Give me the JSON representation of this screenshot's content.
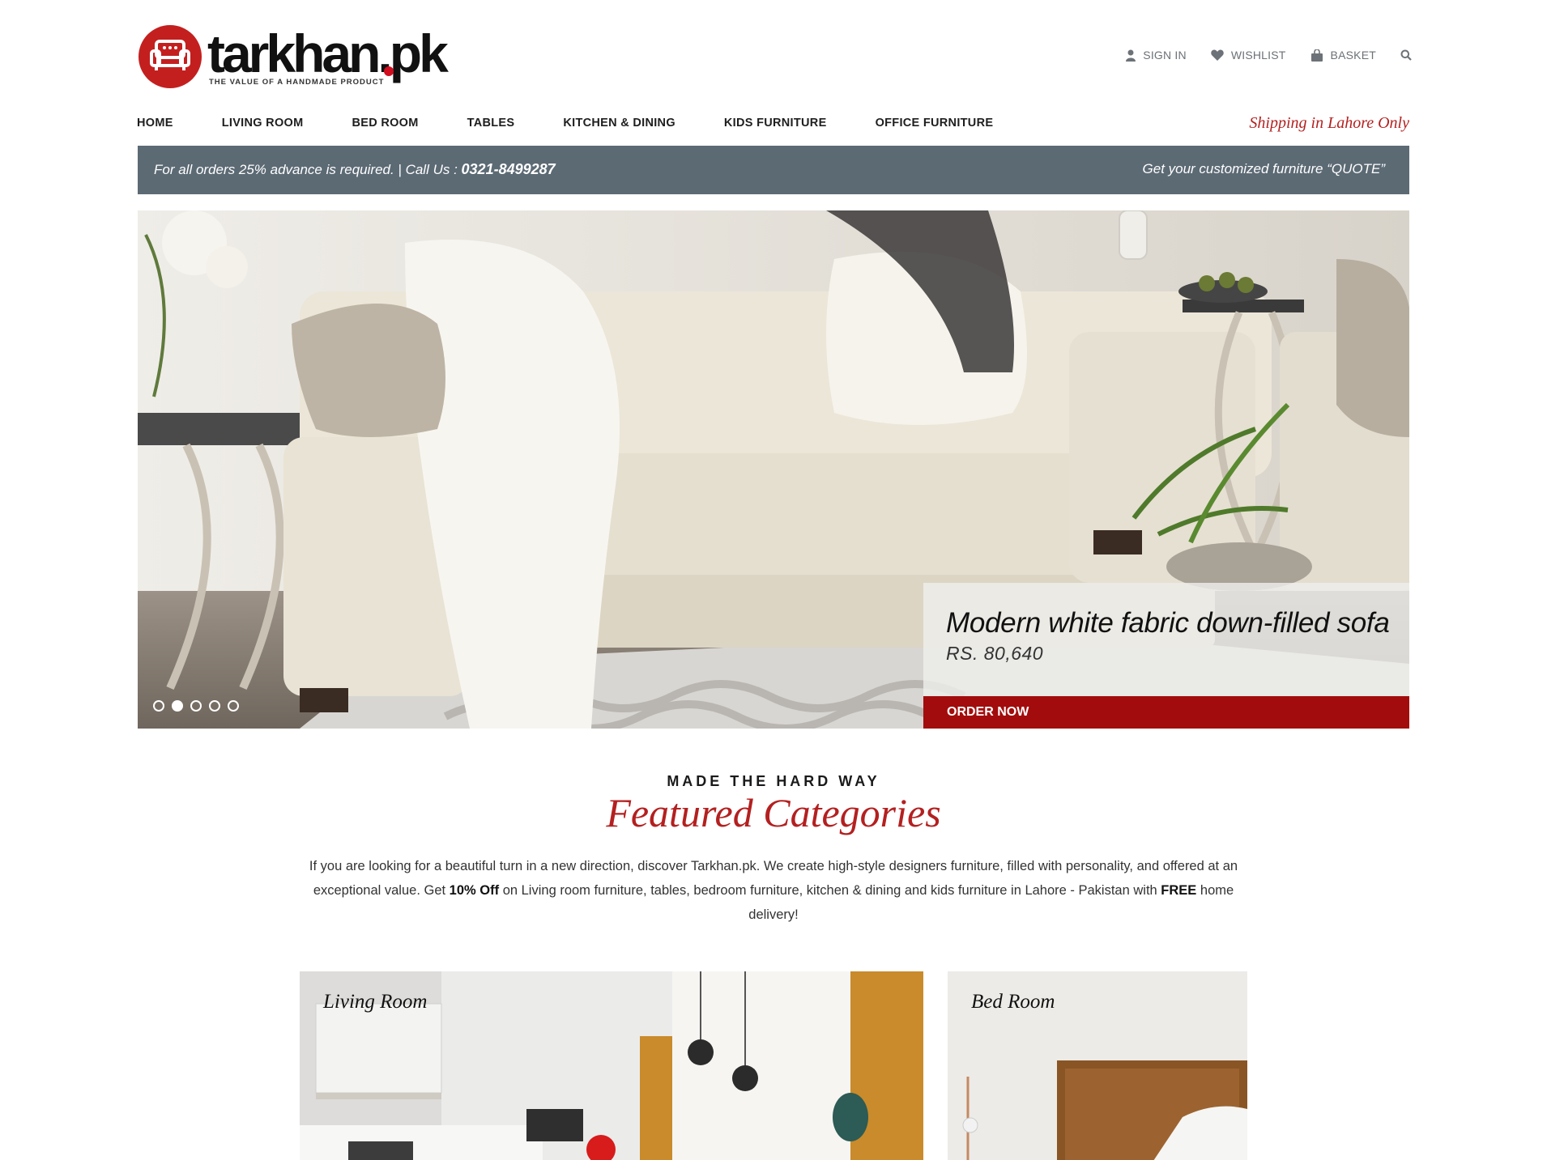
{
  "brand": {
    "name": "tarkhan.pk",
    "tagline": "THE VALUE OF A HANDMADE PRODUCT",
    "brand_color": "#c41f1f"
  },
  "utility_nav": [
    {
      "label": "SIGN IN",
      "icon": "user-icon"
    },
    {
      "label": "WISHLIST",
      "icon": "heart-icon"
    },
    {
      "label": "BASKET",
      "icon": "basket-icon"
    },
    {
      "label": "",
      "icon": "search-icon"
    }
  ],
  "main_nav": [
    {
      "label": "HOME"
    },
    {
      "label": "LIVING ROOM"
    },
    {
      "label": "BED ROOM"
    },
    {
      "label": "TABLES"
    },
    {
      "label": "KITCHEN & DINING"
    },
    {
      "label": "KIDS FURNITURE"
    },
    {
      "label": "OFFICE FURNITURE"
    }
  ],
  "shipping_note": "Shipping in Lahore Only",
  "promo_bar": {
    "advance_text": "For all orders 25% advance is required.  |  Call Us : ",
    "phone": "0321-8499287",
    "quote_text": "Get your customized furniture “QUOTE”",
    "bar_color": "#5c6a74"
  },
  "hero": {
    "title": "Modern white fabric down-filled sofa",
    "price": "RS. 80,640",
    "cta_label": "ORDER NOW",
    "slides_total": 5,
    "active_slide": 2,
    "cta_color": "#a30c0c"
  },
  "featured": {
    "eyebrow": "MADE THE HARD WAY",
    "title": "Featured Categories",
    "intro_part1": "If you are looking for a beautiful turn in a new direction, discover Tarkhan.pk. We create high-style designers furniture, filled with personality, and offered at an exceptional value. Get ",
    "intro_bold1": "10% Off",
    "intro_part2": " on Living room furniture, tables, bedroom furniture, kitchen & dining and kids furniture in Lahore - Pakistan with ",
    "intro_bold2": "FREE",
    "intro_part3": " home delivery!",
    "categories": [
      {
        "label": "Living Room"
      },
      {
        "label": "Bed Room"
      }
    ]
  }
}
